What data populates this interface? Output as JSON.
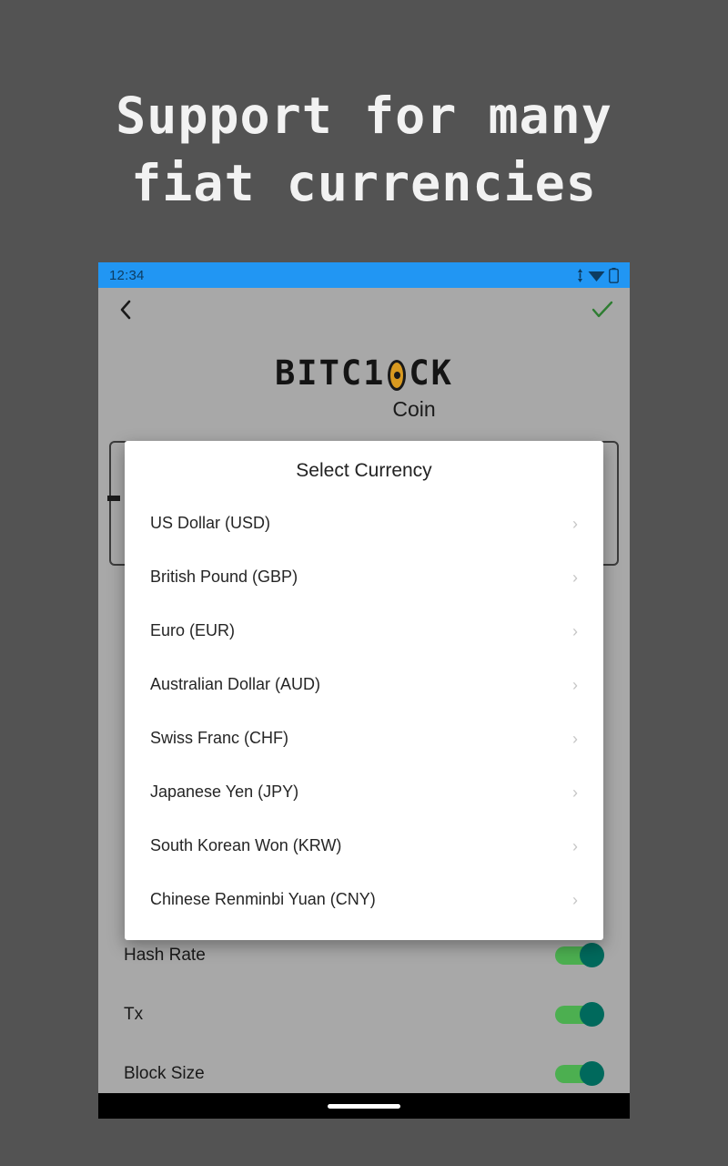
{
  "headline": "Support for many\nfiat currencies",
  "phone": {
    "statusbar": {
      "time": "12:34",
      "icons": [
        "data-transfer-icon",
        "wifi-icon",
        "battery-icon"
      ]
    },
    "appbar": {
      "back_icon": "chevron-left-icon",
      "confirm_icon": "check-icon",
      "confirm_color": "#2e7d32"
    },
    "logo": {
      "part1": "BITC1",
      "zero": "0",
      "part2": "CK",
      "subtitle": "Coin",
      "zero_color": "#d99a20"
    },
    "background_rows": [
      {
        "label": "Hash Rate",
        "toggle": "on"
      },
      {
        "label": "Tx",
        "toggle": "on"
      },
      {
        "label": "Block Size",
        "toggle": "on"
      }
    ],
    "toggle_colors": {
      "track": "#4caf50",
      "thumb": "#00695c"
    },
    "navbar": {
      "home_indicator": "home-indicator"
    }
  },
  "dialog": {
    "title": "Select Currency",
    "chevron": "›",
    "items": [
      {
        "label": "US Dollar (USD)"
      },
      {
        "label": "British Pound (GBP)"
      },
      {
        "label": "Euro (EUR)"
      },
      {
        "label": "Australian Dollar (AUD)"
      },
      {
        "label": "Swiss Franc (CHF)"
      },
      {
        "label": "Japanese Yen (JPY)"
      },
      {
        "label": "South Korean Won (KRW)"
      },
      {
        "label": "Chinese Renminbi Yuan (CNY)"
      }
    ]
  },
  "colors": {
    "page_background": "#535353",
    "statusbar": "#2196f3",
    "phone_background": "#a8a8a8",
    "dialog_background": "#ffffff",
    "headline_text": "#f2f2f2"
  }
}
